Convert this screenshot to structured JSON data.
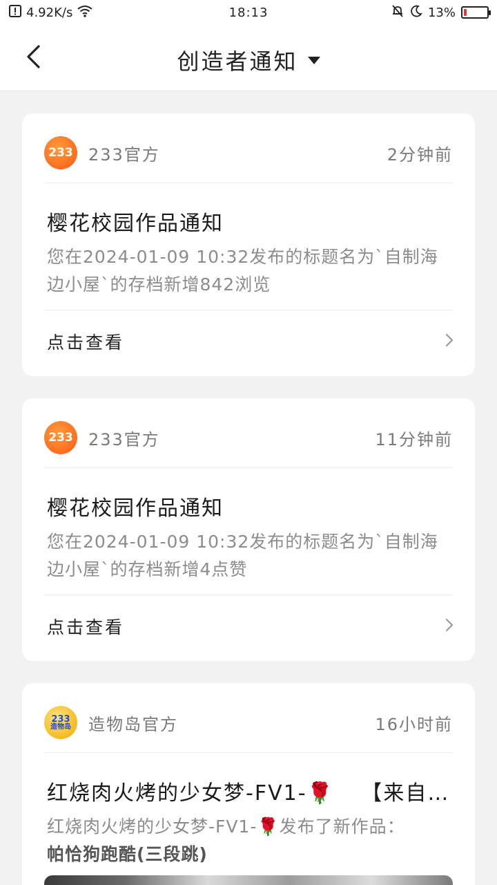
{
  "status_bar": {
    "net_speed": "4.92K/s",
    "time": "18:13",
    "battery": "13%",
    "battery_level": 0.13,
    "icons": [
      "alert-icon",
      "wifi-icon",
      "mute-bell-icon",
      "moon-icon",
      "battery-icon"
    ]
  },
  "nav": {
    "title": "创造者通知",
    "back_icon": "back-arrow-icon",
    "dropdown_icon": "caret-down-icon"
  },
  "notifications": [
    {
      "sender": "233官方",
      "avatar_text": "233",
      "time": "2分钟前",
      "title": "樱花校园作品通知",
      "body": "您在2024-01-09 10:32发布的标题名为`自制海边小屋`的存档新增842浏览",
      "action": "点击查看"
    },
    {
      "sender": "233官方",
      "avatar_text": "233",
      "time": "11分钟前",
      "title": "樱花校园作品通知",
      "body": "您在2024-01-09 10:32发布的标题名为`自制海边小屋`的存档新增4点赞",
      "action": "点击查看"
    },
    {
      "sender": "造物岛官方",
      "avatar_text": "233",
      "avatar_sub": "造物岛",
      "time": "16小时前",
      "title": "红烧肉火烤的少女梦-FV1-",
      "title_suffix": "【来自…",
      "body": "红烧肉火烤的少女梦-FV1-",
      "body_suffix": "发布了新作品：",
      "body_bold": "帕恰狗跑酷(三段跳)",
      "rose": "🌹"
    }
  ]
}
